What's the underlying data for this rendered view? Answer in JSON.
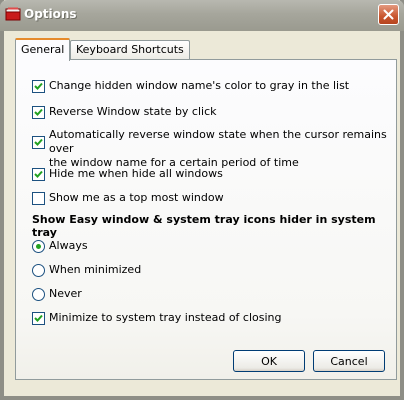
{
  "window": {
    "title": "Options"
  },
  "tabs": [
    {
      "label": "General",
      "active": true
    },
    {
      "label": "Keyboard Shortcuts",
      "active": false
    }
  ],
  "options": {
    "gray_hidden": {
      "label": "Change hidden window name's color to gray in the list",
      "checked": true
    },
    "reverse_click": {
      "label": "Reverse Window state by click",
      "checked": true
    },
    "auto_reverse": {
      "line1": "Automatically reverse window state when the cursor remains over",
      "line2": "the window name for a certain period of time",
      "checked": true
    },
    "hide_me": {
      "label": "Hide me when hide all windows",
      "checked": true
    },
    "top_most": {
      "label": "Show me as a top most window",
      "checked": false
    }
  },
  "tray": {
    "heading": "Show Easy window & system tray icons hider in system tray",
    "always": {
      "label": "Always",
      "selected": true
    },
    "minimized": {
      "label": "When minimized",
      "selected": false
    },
    "never": {
      "label": "Never",
      "selected": false
    }
  },
  "minimize_to_tray": {
    "label": "Minimize to system tray instead of closing",
    "checked": true
  },
  "buttons": {
    "ok": "OK",
    "cancel": "Cancel"
  },
  "colors": {
    "check": "#21a121",
    "tab_highlight": "#e68b2c"
  }
}
